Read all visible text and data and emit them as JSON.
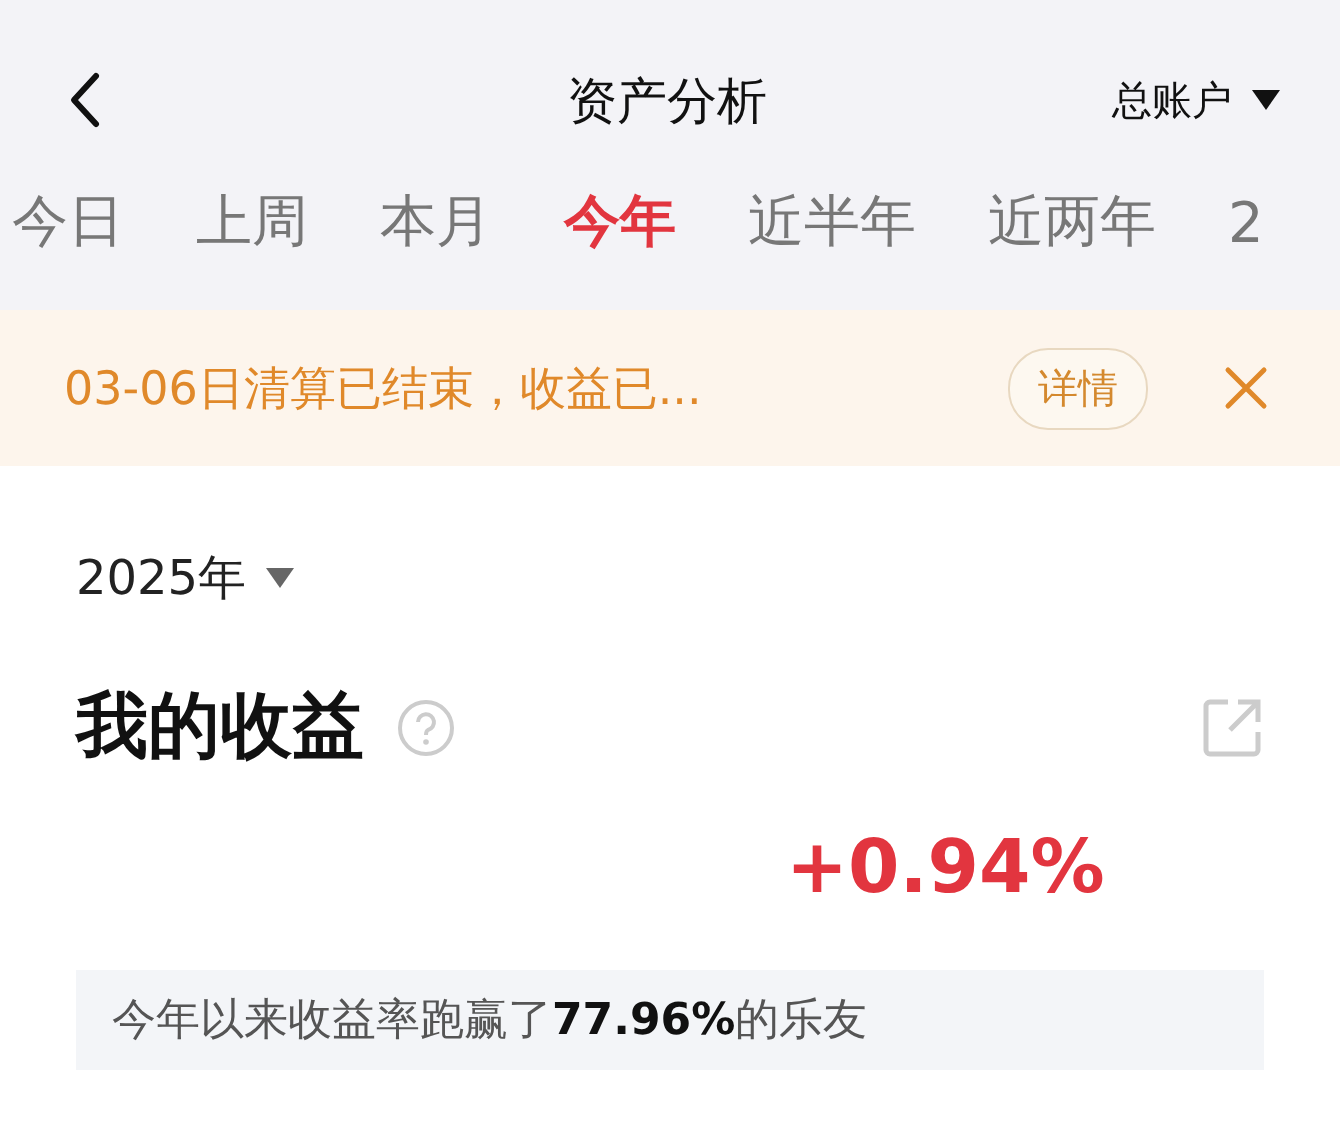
{
  "nav": {
    "title": "资产分析",
    "account": "总账户"
  },
  "tabs": [
    {
      "label": "今日",
      "selected": false
    },
    {
      "label": "上周",
      "selected": false
    },
    {
      "label": "本月",
      "selected": false
    },
    {
      "label": "今年",
      "selected": true
    },
    {
      "label": "近半年",
      "selected": false
    },
    {
      "label": "近两年",
      "selected": false
    },
    {
      "label": "2",
      "selected": false
    }
  ],
  "notice": {
    "text": "03-06日清算已结束，收益已...",
    "button": "详情"
  },
  "year": "2025年",
  "earnings": {
    "title": "我的收益",
    "return": "+0.94%",
    "beat": "今年以来收益率跑赢了**77.96%**的乐友"
  }
}
